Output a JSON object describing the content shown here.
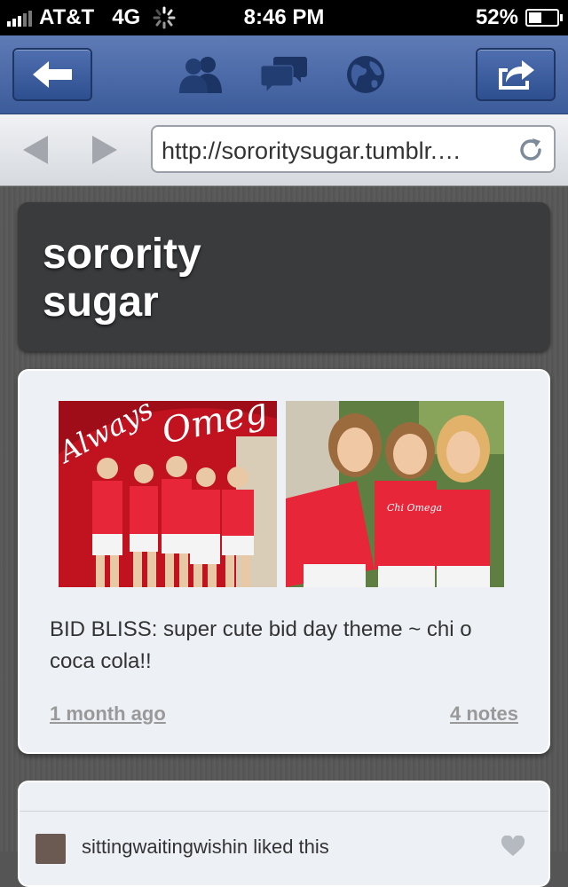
{
  "status_bar": {
    "carrier": "AT&T",
    "network": "4G",
    "time": "8:46 PM",
    "battery": "52%",
    "battery_level": 0.52
  },
  "top_nav": {
    "icons": [
      "back-arrow-icon",
      "friends-icon",
      "messages-icon",
      "globe-icon",
      "share-icon"
    ]
  },
  "browser": {
    "url": "http://sororitysugar.tumblr.…"
  },
  "blog": {
    "title": "sorority sugar"
  },
  "post": {
    "caption": "BID BLISS: super cute bid day theme ~ chi o coca cola!!",
    "time_ago": "1 month ago",
    "notes": "4 notes",
    "photo1_text": "Always Chi Omega",
    "photo2_text": "Chi Omega"
  },
  "note": {
    "text": "sittingwaitingwishin liked this"
  }
}
